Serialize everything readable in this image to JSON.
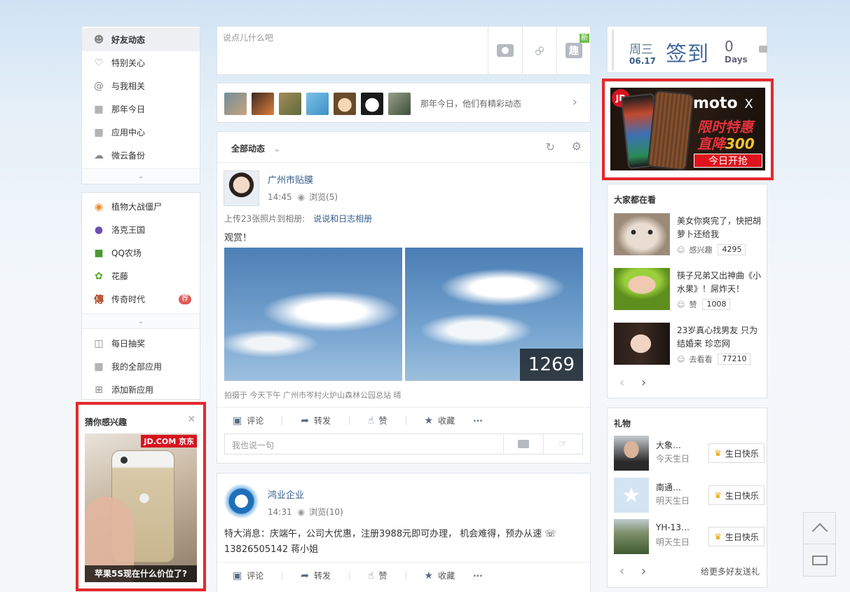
{
  "left_nav": {
    "items": [
      {
        "label": "好友动态",
        "icon": "user-pair-icon"
      },
      {
        "label": "特别关心",
        "icon": "heart-icon"
      },
      {
        "label": "与我相关",
        "icon": "at-icon"
      },
      {
        "label": "那年今日",
        "icon": "calendar-icon"
      },
      {
        "label": "应用中心",
        "icon": "grid-icon"
      },
      {
        "label": "微云备份",
        "icon": "cloud-icon"
      }
    ],
    "apps": [
      {
        "label": "植物大战僵尸"
      },
      {
        "label": "洛克王国"
      },
      {
        "label": "QQ农场"
      },
      {
        "label": "花藤"
      },
      {
        "label": "传奇时代",
        "badge": "荐"
      }
    ],
    "tools": [
      {
        "label": "每日抽奖"
      },
      {
        "label": "我的全部应用"
      },
      {
        "label": "添加新应用"
      }
    ]
  },
  "guess_ad": {
    "title": "猜你感兴趣",
    "brand": "JD.COM 京东",
    "caption": "苹果5S现在什么价位了?"
  },
  "composer": {
    "placeholder": "说点儿什么吧",
    "new_badge": "新",
    "fun_label": "趣"
  },
  "memories": {
    "text": "那年今日，他们有精彩动态"
  },
  "feed": {
    "filter_label": "全部动态",
    "posts": [
      {
        "author": "广州市贴膜",
        "time": "14:45",
        "views": "浏览(5)",
        "upload_text": "上传23张照片到相册:",
        "album": "说说和日志相册",
        "content": "观赏！",
        "photo_count": "1269",
        "location": "拍摄于 今天下午 广州市岑村火炉山森林公园总站 晴",
        "actions": [
          "评论",
          "转发",
          "赞",
          "收藏",
          "···"
        ],
        "comment_placeholder": "我也说一句"
      },
      {
        "author": "鸿业企业",
        "time": "14:31",
        "views": "浏览(10)",
        "content": "特大消息：庆端午，公司大优惠，注册3988元即可办理， 机会难得，预办从速 ☏ 13826505142 蒋小姐",
        "actions": [
          "评论",
          "转发",
          "赞",
          "收藏",
          "···"
        ]
      }
    ]
  },
  "signin": {
    "weekday": "周三",
    "date": "06.17",
    "label": "签到",
    "days_count": "0",
    "days_label": "Days"
  },
  "moto_ad": {
    "jd_label": "JD",
    "brand": "moto",
    "model": "X",
    "line1": "限时特惠",
    "line2_prefix": "直降",
    "line2_amount": "300",
    "cta": "今日开抢"
  },
  "hot": {
    "title": "大家都在看",
    "items": [
      {
        "title": "美女你爽完了，快把胡萝卜还给我",
        "action": "感兴趣",
        "count": "4295"
      },
      {
        "title": "筷子兄弟又出神曲《小水果》！屌炸天！",
        "action": "赞",
        "count": "1008"
      },
      {
        "title": "23岁真心找男友 只为结婚来 珍恋网",
        "action": "去看看",
        "count": "77210"
      }
    ]
  },
  "gifts": {
    "title": "礼物",
    "items": [
      {
        "name": "大象…",
        "when": "今天生日",
        "button": "生日快乐"
      },
      {
        "name": "南通…",
        "when": "明天生日",
        "button": "生日快乐"
      },
      {
        "name": "YH-13…",
        "when": "明天生日",
        "button": "生日快乐"
      }
    ],
    "more": "给更多好友送礼"
  },
  "colors": {
    "accent_red": "#e6282c",
    "link_blue": "#335d8c",
    "page_bg": "#f5f7fa"
  }
}
